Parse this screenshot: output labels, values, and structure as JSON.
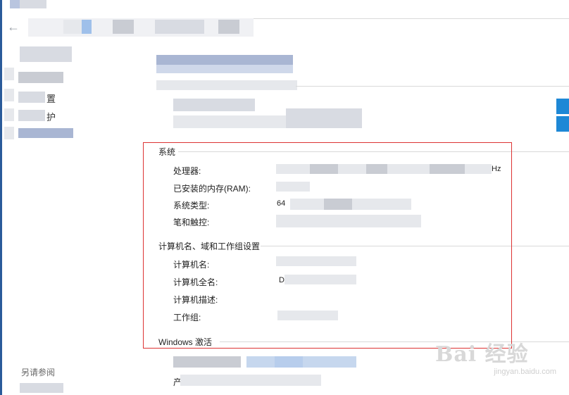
{
  "window": {
    "back_icon": "arrow-left-icon"
  },
  "sidebar": {
    "items": [
      {
        "label": "置"
      },
      {
        "label": "护"
      }
    ],
    "see_also": "另请参阅"
  },
  "system_section": {
    "title": "系统",
    "rows": [
      {
        "label": "处理器:",
        "value": "Hz"
      },
      {
        "label": "已安装的内存(RAM):",
        "value": ""
      },
      {
        "label": "系统类型:",
        "value": "64"
      },
      {
        "label": "笔和触控:",
        "value": ""
      }
    ]
  },
  "computer_section": {
    "title": "计算机名、域和工作组设置",
    "rows": [
      {
        "label": "计算机名:",
        "value": ""
      },
      {
        "label": "计算机全名:",
        "value": "D"
      },
      {
        "label": "计算机描述:",
        "value": ""
      },
      {
        "label": "工作组:",
        "value": ""
      }
    ]
  },
  "activation_section": {
    "title": "Windows 激活",
    "product_prefix": "产"
  },
  "watermark": {
    "brand": "Bai 经验",
    "url": "jingyan.baidu.com"
  },
  "colors": {
    "highlight_border": "#dd3333",
    "windows_logo": "#1e88d6",
    "left_edge": "#2a5b9a"
  }
}
